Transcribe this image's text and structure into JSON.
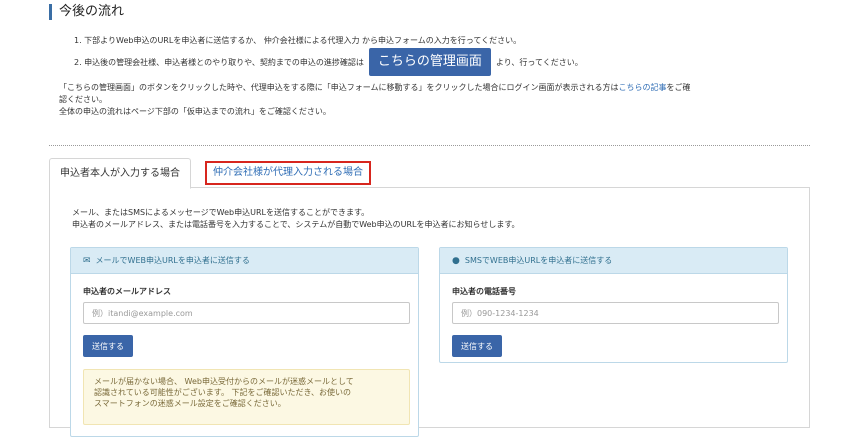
{
  "header": {
    "title": "今後の流れ"
  },
  "steps": {
    "step1": "1. 下部よりWeb申込のURLを申込者に送信するか、 仲介会社様による代理入力 から申込フォームの入力を行ってください。",
    "step2_prefix": "2. 申込後の管理会社様、申込者様とのやり取りや、契約までの申込の進捗確認は",
    "step2_button": "こちらの管理画面",
    "step2_suffix": "より、行ってください。"
  },
  "notes": {
    "line1_part1": "「こちらの管理画面」のボタンをクリックした時や、代理申込をする際に「申込フォームに移動する」をクリックした場合にログイン画面が表示される方は",
    "line1_link": "こちらの記事",
    "line1_part2": "をご確",
    "line2": "認ください。",
    "line3": "全体の申込の流れはページ下部の「仮申込までの流れ」をご確認ください。"
  },
  "tabs": {
    "self": "申込者本人が入力する場合",
    "proxy": "仲介会社様が代理入力される場合"
  },
  "panel": {
    "desc_line1": "メール、またはSMSによるメッセージでWeb申込URLを送信することができます。",
    "desc_line2": "申込者のメールアドレス、または電話番号を入力することで、システムが自動でWeb申込のURLを申込者にお知らせします。"
  },
  "mail_card": {
    "icon": "envelope-icon",
    "title": "メールでWEB申込URLを申込者に送信する",
    "field_label": "申込者のメールアドレス",
    "placeholder": "例）itandi@example.com",
    "value": "",
    "send_label": "送信する",
    "warning_line1": "メールが届かない場合、 Web申込受付からのメールが迷惑メールとして",
    "warning_line2": "認識されている可能性がございます。 下記をご確認いただき、お使いの",
    "warning_line3": "スマートフォンの迷惑メール設定をご確認ください。"
  },
  "sms_card": {
    "icon": "speech-bubble-icon",
    "title": "SMSでWEB申込URLを申込者に送信する",
    "field_label": "申込者の電話番号",
    "placeholder": "例）090-1234-1234",
    "value": "",
    "send_label": "送信する"
  },
  "colors": {
    "accent": "#3a65a8",
    "link": "#2f6db5",
    "highlight_border": "#d7261e",
    "card_header": "#d9ebf5",
    "warning_bg": "#fcf8e3"
  }
}
